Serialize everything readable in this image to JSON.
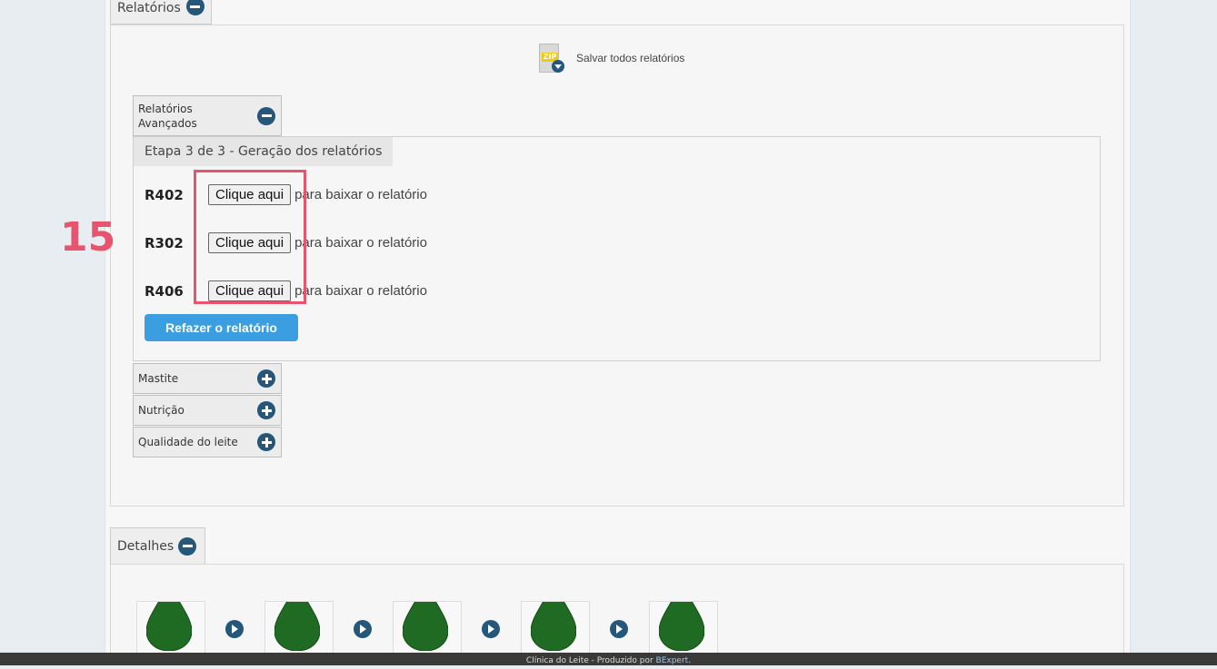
{
  "sections": {
    "relatorios_label": "Relatórios",
    "detalhes_label": "Detalhes"
  },
  "zip": {
    "icon_text": "ZIP",
    "label": "Salvar todos relatórios"
  },
  "accordion": {
    "avancados_line1": "Relatórios",
    "avancados_line2": "Avançados",
    "mastite": "Mastite",
    "nutricao": "Nutrição",
    "qualidade": "Qualidade do leite"
  },
  "etapa": "Etapa 3 de 3 - Geração dos relatórios",
  "reports": [
    {
      "code": "R402",
      "button": "Clique aqui",
      "text": "para baixar o relatório"
    },
    {
      "code": "R302",
      "button": "Clique aqui",
      "text": "para baixar o relatório"
    },
    {
      "code": "R406",
      "button": "Clique aqui",
      "text": "para baixar o relatório"
    }
  ],
  "refazer_label": "Refazer o relatório",
  "annotation_number": "15",
  "footer": {
    "prefix": "Clínica do Leite - Produzido por ",
    "link": "BExpert",
    "suffix": "."
  },
  "colors": {
    "accent": "#3a9ee0",
    "icon": "#24577a",
    "highlight": "#e8546e",
    "drop": "#1f6b24"
  },
  "icons": {
    "collapse": "minus-circle-icon",
    "expand": "plus-circle-icon",
    "step_arrow": "arrow-right-icon",
    "drop": "milk-drop-icon"
  }
}
